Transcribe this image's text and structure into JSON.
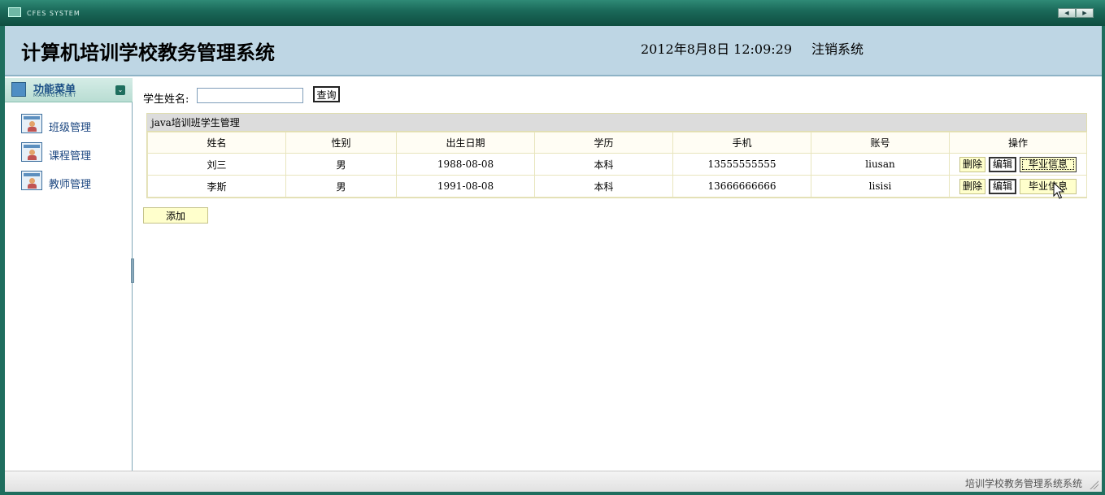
{
  "window": {
    "brand": "CFES SYSTEM",
    "nav_prev_icon": "triangle-left",
    "nav_next_icon": "triangle-right",
    "nav_prev": "◀",
    "nav_next": "▶"
  },
  "header": {
    "title": "计算机培训学校教务管理系统",
    "clock": "2012年8月8日  12:09:29",
    "logout": "注销系统"
  },
  "sidebar": {
    "title": "功能菜单",
    "subtitle": "MANAGEMENT",
    "toggle": "⌄",
    "items": [
      {
        "label": "班级管理",
        "icon": "user-card-icon"
      },
      {
        "label": "课程管理",
        "icon": "user-card-icon"
      },
      {
        "label": "教师管理",
        "icon": "user-card-icon"
      }
    ]
  },
  "search": {
    "label": "学生姓名:",
    "value": "",
    "placeholder": "",
    "button": "查询"
  },
  "grid": {
    "caption": "java培训班学生管理",
    "columns": [
      "姓名",
      "性别",
      "出生日期",
      "学历",
      "手机",
      "账号",
      "操作"
    ],
    "rows": [
      {
        "name": "刘三",
        "gender": "男",
        "birth": "1988-08-08",
        "education": "本科",
        "phone": "13555555555",
        "account": "liusan"
      },
      {
        "name": "李斯",
        "gender": "男",
        "birth": "1991-08-08",
        "education": "本科",
        "phone": "13666666666",
        "account": "lisisi"
      }
    ],
    "actions": {
      "delete": "删除",
      "edit": "编辑",
      "graduation": "毕业信息"
    }
  },
  "add_button": "添加",
  "status": {
    "text": "培训学校教务管理系统系统"
  },
  "colors": {
    "frame": "#1f6e5e",
    "header_bg": "#bed6e4",
    "button_yellow": "#ffffcc",
    "menu_text": "#1b4680"
  }
}
